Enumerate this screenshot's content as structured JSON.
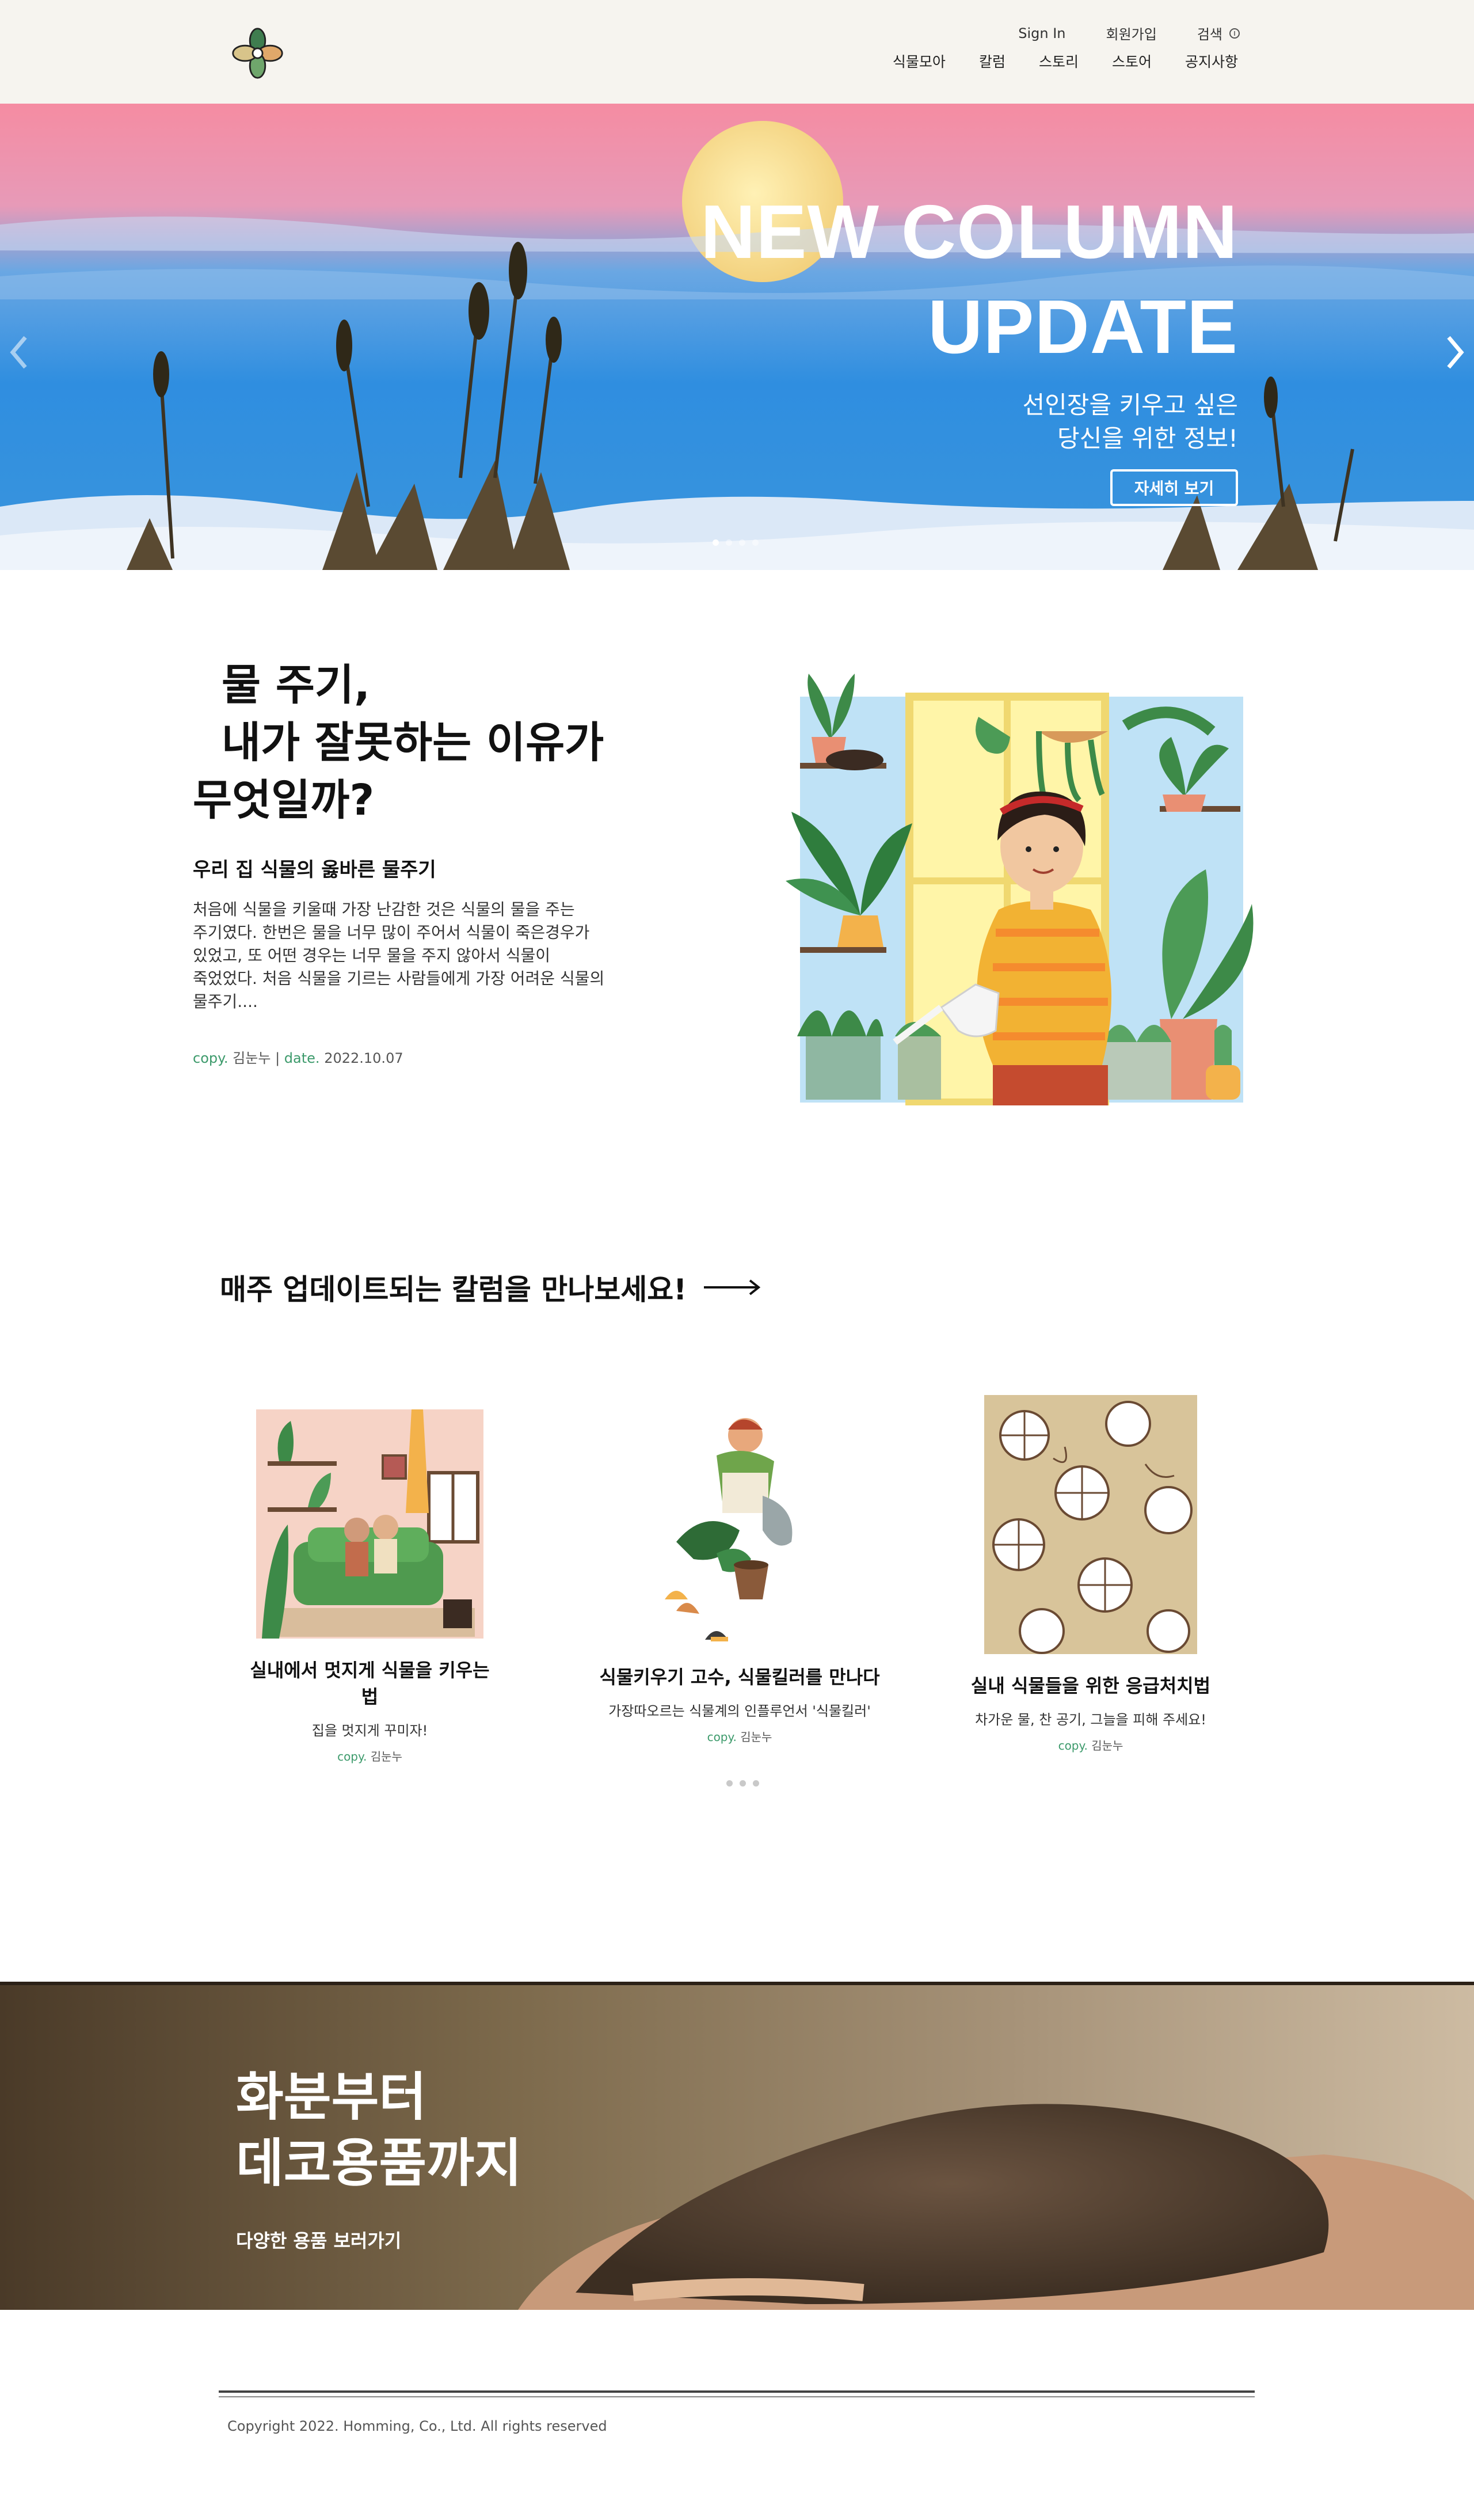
{
  "header": {
    "top_links": [
      "Sign In",
      "회원가입",
      "검색"
    ],
    "nav": [
      "식물모아",
      "칼럼",
      "스토리",
      "스토어",
      "공지사항"
    ]
  },
  "hero": {
    "title_line1": "NEW COLUMN",
    "title_line2": "UPDATE",
    "subtitle_line1": "선인장을 키우고 싶은",
    "subtitle_line2": "당신을 위한 정보!",
    "button": "자세히 보기",
    "slide_count": 4,
    "active_slide": 1
  },
  "feature": {
    "title_line1": "물 주기,",
    "title_line2": "내가 잘못하는 이유가",
    "title_line3": "무엇일까?",
    "subtitle": "우리 집 식물의 옳바른 물주기",
    "body_lines": [
      "처음에 식물을 키울때 가장 난감한 것은 식물의 물을 주는",
      "주기였다. 한번은 물을 너무 많이 주어서 식물이 죽은경우가",
      "있었고, 또 어떤 경우는 너무 물을 주지 않아서 식물이",
      "죽었었다. 처음 식물을 기르는 사람들에게 가장 어려운 식물의",
      "물주기...."
    ],
    "meta_copy_label": "copy.",
    "meta_author": "김눈누",
    "meta_sep": "|",
    "meta_date_label": "date.",
    "meta_date": "2022.10.07"
  },
  "weekly": {
    "heading": "매주 업데이트되는 칼럼을 만나보세요!",
    "cards": [
      {
        "title": "실내에서 멋지게 식물을 키우는 법",
        "subtitle": "집을 멋지게 꾸미자!",
        "copy_label": "copy.",
        "author": "김눈누"
      },
      {
        "title": "식물키우기 고수, 식물킬러를 만나다",
        "subtitle": "가장따오르는 식물계의 인플루언서 '식물킬러'",
        "copy_label": "copy.",
        "author": "김눈누"
      },
      {
        "title": "실내 식물들을 위한 응급처치법",
        "subtitle": "차가운 물, 찬 공기, 그늘을 피해 주세요!",
        "copy_label": "copy.",
        "author": "김눈누"
      }
    ],
    "page_count": 3
  },
  "banner": {
    "title_line1": "화분부터",
    "title_line2": "데코용품까지",
    "link": "다양한 용품 보러가기"
  },
  "footer": {
    "copyright": "Copyright 2022. Homming, Co., Ltd. All rights reserved"
  },
  "colors": {
    "header_bg": "#f6f4ef",
    "accent_green": "#3c9a6b",
    "hero_sky_top": "#f48fa3",
    "hero_sky_bottom": "#2a8fe0"
  }
}
